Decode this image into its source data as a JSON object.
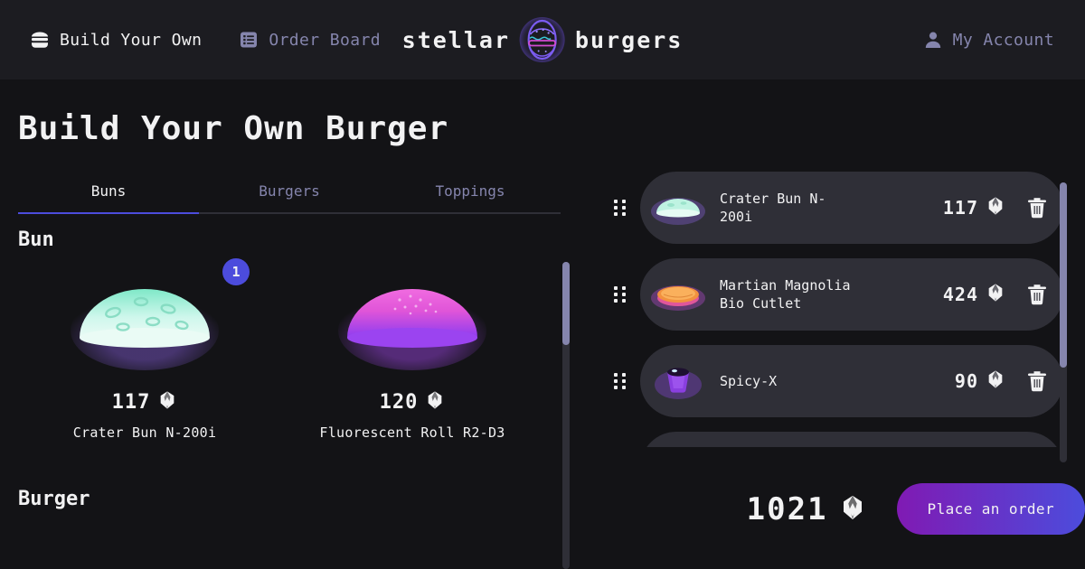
{
  "header": {
    "nav": [
      {
        "label": "Build Your Own",
        "icon": "burger-icon",
        "active": true
      },
      {
        "label": "Order Board",
        "icon": "list-icon",
        "active": false
      }
    ],
    "logo": {
      "left_word": "stellar",
      "right_word": "burgers",
      "icon": "burger-logo-icon"
    },
    "account": {
      "label": "My Account",
      "icon": "person-icon"
    }
  },
  "page_title": "Build Your Own Burger",
  "tabs": [
    {
      "label": "Buns",
      "active": true
    },
    {
      "label": "Burgers",
      "active": false
    },
    {
      "label": "Toppings",
      "active": false
    }
  ],
  "sections": [
    {
      "title": "Bun",
      "items": [
        {
          "name": "Crater Bun N-200i",
          "price": "117",
          "counter": "1",
          "art": "mint-dome"
        },
        {
          "name": "Fluorescent Roll R2-D3",
          "price": "120",
          "counter": "",
          "art": "pink-dome"
        }
      ]
    },
    {
      "title": "Burger",
      "items": []
    }
  ],
  "constructor": {
    "items": [
      {
        "name": "Crater Bun N-200i",
        "price": "117",
        "art": "mint-dome",
        "drag_icon": "drag-handle-icon",
        "delete_icon": "trash-icon"
      },
      {
        "name": "Martian Magnolia Bio Cutlet",
        "price": "424",
        "art": "orange-patty",
        "drag_icon": "drag-handle-icon",
        "delete_icon": "trash-icon"
      },
      {
        "name": "Spicy-X",
        "price": "90",
        "art": "purple-sauce",
        "drag_icon": "drag-handle-icon",
        "delete_icon": "trash-icon"
      }
    ],
    "total": "1021",
    "currency_icon": "gem-icon",
    "order_button": "Place an order"
  },
  "colors": {
    "accent": "#4C4CDC",
    "accent_purple": "#801AB3",
    "background": "#131316",
    "surface": "#1C1C21",
    "card": "#2F2F37",
    "text_primary": "#F2F2F3",
    "text_muted": "#8585AD"
  }
}
